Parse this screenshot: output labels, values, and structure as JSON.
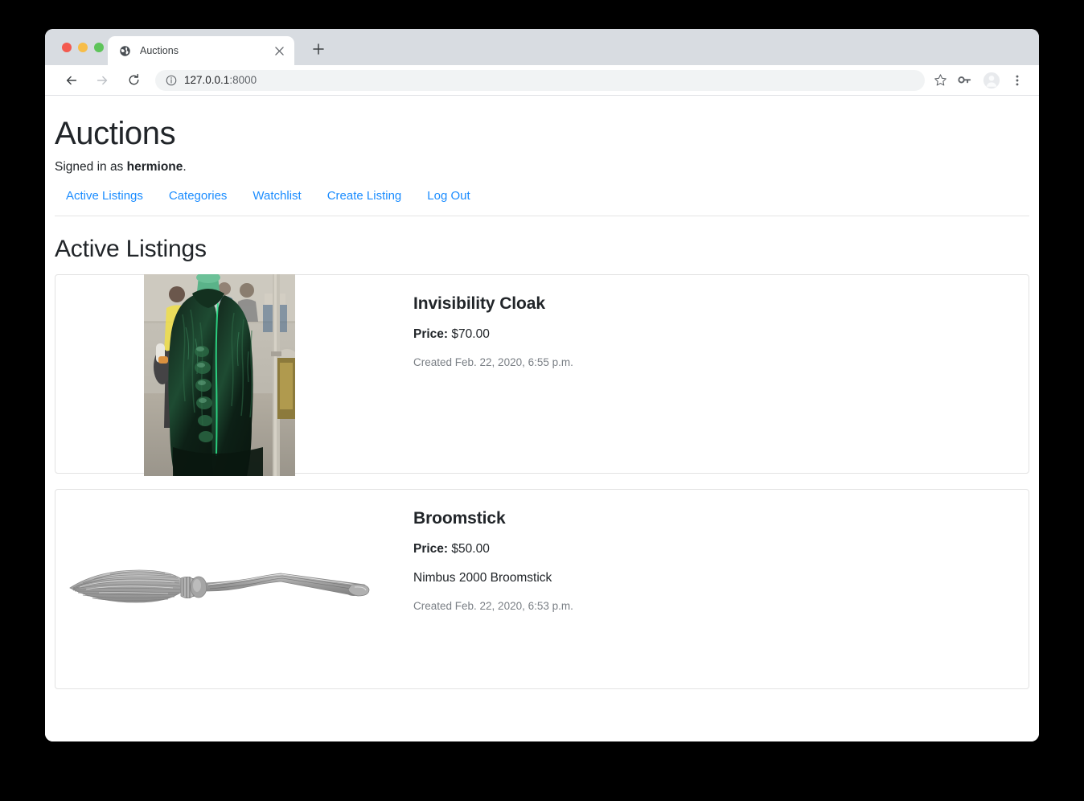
{
  "browser": {
    "tab": {
      "title": "Auctions",
      "favicon": "globe-icon",
      "close": "×"
    },
    "new_tab": "+",
    "back": "←",
    "forward": "→",
    "reload": "⟳",
    "omnibox": {
      "info_icon": "info-circle-icon",
      "url_host": "127.0.0.1",
      "url_port": ":8000"
    },
    "toolbar_icons": {
      "bookmark": "star-icon",
      "password": "key-icon",
      "profile": "avatar-icon",
      "menu": "three-dot-menu-icon"
    }
  },
  "page": {
    "title": "Auctions",
    "signed_in_prefix": "Signed in as ",
    "signed_in_user": "hermione",
    "signed_in_suffix": ".",
    "nav": [
      {
        "label": "Active Listings"
      },
      {
        "label": "Categories"
      },
      {
        "label": "Watchlist"
      },
      {
        "label": "Create Listing"
      },
      {
        "label": "Log Out"
      }
    ],
    "section_title": "Active Listings",
    "price_label": "Price:",
    "listings": [
      {
        "name": "Invisibility Cloak",
        "price": "$70.00",
        "description": "",
        "created": "Created Feb. 22, 2020, 6:55 p.m.",
        "image_alt": "invisibility-cloak-photo"
      },
      {
        "name": "Broomstick",
        "price": "$50.00",
        "description": "Nimbus 2000 Broomstick",
        "created": "Created Feb. 22, 2020, 6:53 p.m.",
        "image_alt": "broomstick-illustration"
      }
    ]
  },
  "colors": {
    "link": "#1a8cff",
    "text": "#212529",
    "muted": "#7a7f85",
    "card_border": "#e3e3e3",
    "tabstrip": "#d8dce1"
  }
}
